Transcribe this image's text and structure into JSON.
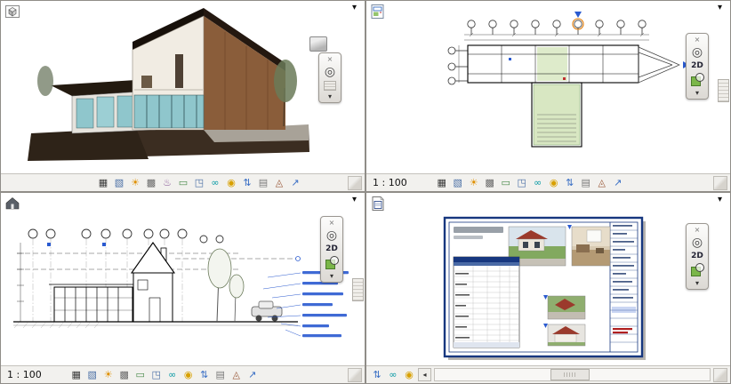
{
  "nav": {
    "menu_arrow": "▾",
    "close": "×",
    "wheel": "◎",
    "caret": "▾",
    "label_2d": "2D"
  },
  "view_bars": {
    "top_right": {
      "scale": "1 : 100"
    },
    "bottom_left": {
      "scale": "1 : 100"
    }
  },
  "scrollbar": {
    "left_arrow": "◂"
  },
  "icon_rows": {
    "view3d": [
      "detail-level",
      "visual-style",
      "sun-path",
      "shadows",
      "show-rendering-dialog",
      "crop-view",
      "show-crop-region",
      "temporary-hide-isolate",
      "reveal-hidden-elements",
      "worksharing-display",
      "temporary-view-properties",
      "analytical-model",
      "highlight-displacement"
    ],
    "view2d": [
      "detail-level",
      "visual-style",
      "sun-path",
      "shadows",
      "crop-view",
      "show-crop-region",
      "temporary-hide-isolate",
      "reveal-hidden-elements",
      "worksharing-display",
      "temporary-view-properties",
      "analytical-model",
      "highlight-displacement"
    ],
    "sheet": [
      "worksharing-display",
      "temporary-hide-isolate",
      "reveal-hidden-elements"
    ]
  },
  "icon_defs": {
    "detail-level": {
      "g": "▦",
      "c": "#3a3a3a"
    },
    "visual-style": {
      "g": "▧",
      "c": "#4a6fa5"
    },
    "sun-path": {
      "g": "☀",
      "c": "#e09000"
    },
    "shadows": {
      "g": "▩",
      "c": "#6a6a6a"
    },
    "show-rendering-dialog": {
      "g": "♨",
      "c": "#8a5a9a"
    },
    "crop-view": {
      "g": "▭",
      "c": "#4a8a4a"
    },
    "show-crop-region": {
      "g": "◳",
      "c": "#4a6fa5"
    },
    "temporary-hide-isolate": {
      "g": "∞",
      "c": "#0a9aa5"
    },
    "reveal-hidden-elements": {
      "g": "◉",
      "c": "#d8a000"
    },
    "worksharing-display": {
      "g": "⇅",
      "c": "#3a6fc5"
    },
    "temporary-view-properties": {
      "g": "▤",
      "c": "#7a7a7a"
    },
    "analytical-model": {
      "g": "◬",
      "c": "#9a5a3a"
    },
    "highlight-displacement": {
      "g": "↗",
      "c": "#3a6fc5"
    }
  },
  "colors": {
    "sheet_border": "#17377f",
    "annotation_blue": "#2a5ad0",
    "room_green": "#d8e7c2",
    "grid_highlight_orange": "#e07800",
    "render_roof_red": "#9b3a2c",
    "control_bar_bg": "#f2f1ee"
  }
}
